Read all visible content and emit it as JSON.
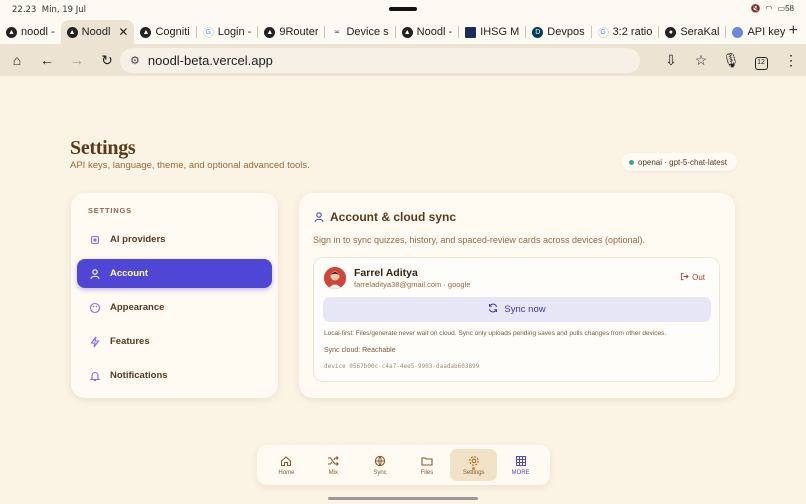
{
  "statusbar": {
    "time": "22.23",
    "date": "Min, 19 Jul",
    "battery": "58"
  },
  "tabs": [
    {
      "label": "noodl -",
      "icon": "noodl-icon",
      "active": false
    },
    {
      "label": "Noodl",
      "icon": "noodl-icon",
      "active": true
    },
    {
      "label": "Cogniti",
      "icon": "noodl-icon",
      "active": false
    },
    {
      "label": "Login -",
      "icon": "google-icon",
      "active": false
    },
    {
      "label": "9Router",
      "icon": "triangle-icon",
      "active": false
    },
    {
      "label": "Device s",
      "icon": "device-icon",
      "active": false
    },
    {
      "label": "Noodl -",
      "icon": "noodl-icon",
      "active": false
    },
    {
      "label": "IHSG M",
      "icon": "chart-icon",
      "active": false
    },
    {
      "label": "Devpos",
      "icon": "devpost-icon",
      "active": false
    },
    {
      "label": "3:2 ratio",
      "icon": "google-icon",
      "active": false
    },
    {
      "label": "SeraKal",
      "icon": "github-icon",
      "active": false
    },
    {
      "label": "API key",
      "icon": "globe-icon",
      "active": false
    }
  ],
  "toolbar": {
    "url": "noodl-beta.vercel.app",
    "tab_count": "12"
  },
  "page": {
    "title": "Settings",
    "subtitle": "API keys, language, theme, and optional advanced tools.",
    "model_badge": "openai · gpt-5-chat-latest"
  },
  "nav": {
    "heading": "SETTINGS",
    "items": [
      {
        "label": "AI providers",
        "active": false
      },
      {
        "label": "Account",
        "active": true
      },
      {
        "label": "Appearance",
        "active": false
      },
      {
        "label": "Features",
        "active": false
      },
      {
        "label": "Notifications",
        "active": false
      }
    ]
  },
  "account": {
    "title": "Account & cloud sync",
    "description": "Sign in to sync quizzes, history, and spaced-review cards across devices (optional).",
    "user_name": "Farrel Aditya",
    "user_email": "farreladitya38@gmail.com · google",
    "logout_label": "Out",
    "sync_button": "Sync now",
    "local_first_note": "Local-first: Files/generate never wait on cloud. Sync only uploads pending saves and pulls changes from other devices.",
    "sync_status": "Sync cloud: Reachable",
    "device_id": "device 0567b00c-c4a7-4ee5-9903-daadab603899"
  },
  "dock": [
    {
      "label": "Home",
      "icon": "home-icon"
    },
    {
      "label": "Mix",
      "icon": "shuffle-icon"
    },
    {
      "label": "Sync",
      "icon": "globe-icon"
    },
    {
      "label": "Files",
      "icon": "folder-icon"
    },
    {
      "label": "Settings",
      "icon": "gear-icon",
      "active": true
    },
    {
      "label": "MORE",
      "icon": "grid-icon"
    }
  ],
  "colors": {
    "accent": "#4f46d6",
    "background": "#fbf3e4",
    "text": "#5a3a1c"
  }
}
